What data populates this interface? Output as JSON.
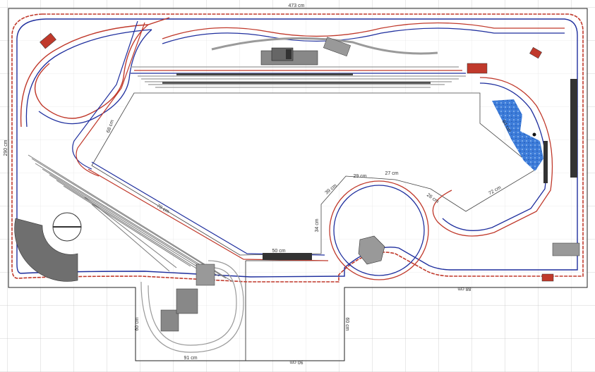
{
  "dimensions": {
    "top_width": "473 cm",
    "left_height": "290 cm",
    "bottom_left_width": "91 cm",
    "bottom_right_width": "90 cm",
    "ext_left_height": "60 cm",
    "ext_right_height": "60 cm",
    "bottom_main_right": "88 cm",
    "inner_left": "68 cm",
    "inner_right_slope": "64 cm",
    "inner_mid_left": "39 cm",
    "inner_mid_bottom": "34 cm",
    "inner_arc_a": "29 cm",
    "inner_arc_b": "26 cm",
    "inner_arc_c": "27 cm",
    "inner_bottom": "70 cm",
    "inner_angled": "50 cm",
    "inner_right_low": "72 cm"
  },
  "colors": {
    "grid": "#c8c8c8",
    "outline": "#222222",
    "track_red": "#c0392b",
    "track_blue": "#1f2f9e",
    "track_grey": "#9a9a9a",
    "water": "#3d7cd9",
    "building": "#777777",
    "turntable": "#6f6f6f"
  }
}
